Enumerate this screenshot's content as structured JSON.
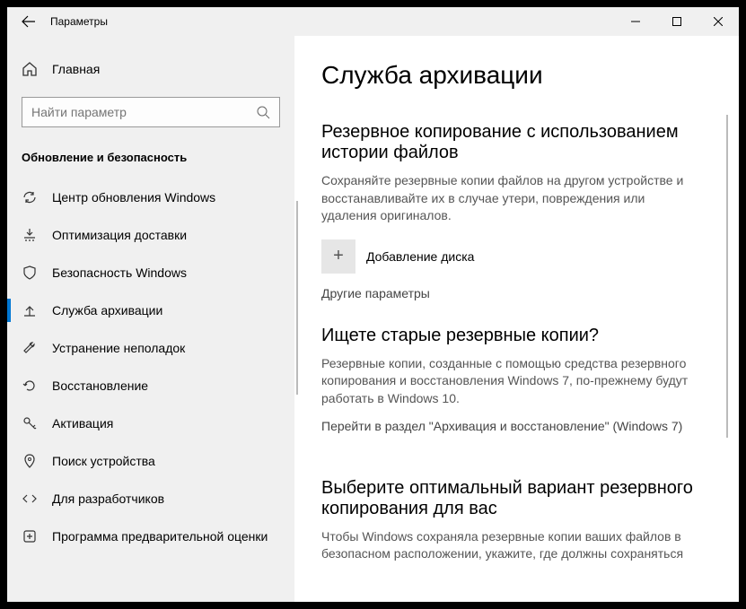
{
  "titlebar": {
    "title": "Параметры"
  },
  "sidebar": {
    "home": "Главная",
    "search_placeholder": "Найти параметр",
    "section": "Обновление и безопасность",
    "items": [
      {
        "label": "Центр обновления Windows"
      },
      {
        "label": "Оптимизация доставки"
      },
      {
        "label": "Безопасность Windows"
      },
      {
        "label": "Служба архивации"
      },
      {
        "label": "Устранение неполадок"
      },
      {
        "label": "Восстановление"
      },
      {
        "label": "Активация"
      },
      {
        "label": "Поиск устройства"
      },
      {
        "label": "Для разработчиков"
      },
      {
        "label": "Программа предварительной оценки"
      }
    ]
  },
  "main": {
    "title": "Служба архивации",
    "h2a": "Резервное копирование с использованием истории файлов",
    "p1": "Сохраняйте резервные копии файлов на другом устройстве и восстанавливайте их в случае утери, повреждения или удаления оригиналов.",
    "add": "Добавление диска",
    "other": "Другие параметры",
    "h2b": "Ищете старые резервные копии?",
    "p2": "Резервные копии, созданные с помощью средства резервного копирования и восстановления Windows 7, по-прежнему будут работать в Windows 10.",
    "link2": "Перейти в раздел \"Архивация и восстановление\" (Windows 7)",
    "h2c": "Выберите оптимальный вариант резервного копирования для вас",
    "p3": "Чтобы Windows сохраняла резервные копии ваших файлов в безопасном расположении, укажите, где должны сохраняться"
  }
}
